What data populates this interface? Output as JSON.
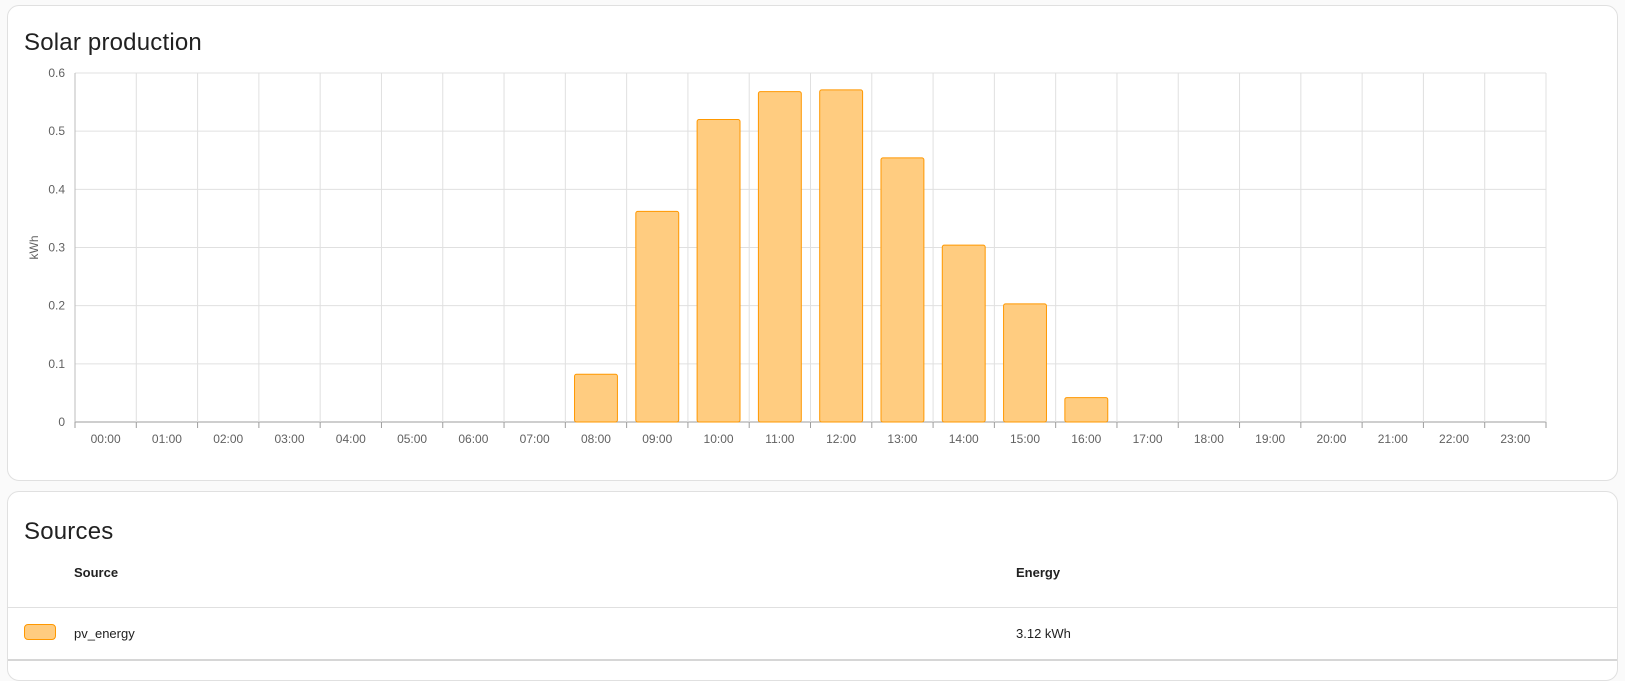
{
  "chart_card": {
    "title": "Solar production"
  },
  "chart_data": {
    "type": "bar",
    "categories": [
      "00:00",
      "01:00",
      "02:00",
      "03:00",
      "04:00",
      "05:00",
      "06:00",
      "07:00",
      "08:00",
      "09:00",
      "10:00",
      "11:00",
      "12:00",
      "13:00",
      "14:00",
      "15:00",
      "16:00",
      "17:00",
      "18:00",
      "19:00",
      "20:00",
      "21:00",
      "22:00",
      "23:00"
    ],
    "values": [
      0,
      0,
      0,
      0,
      0,
      0,
      0,
      0,
      0.082,
      0.362,
      0.52,
      0.568,
      0.571,
      0.454,
      0.304,
      0.203,
      0.042,
      0,
      0,
      0,
      0,
      0,
      0,
      0
    ],
    "ylabel": "kWh",
    "ylim": [
      0,
      0.6
    ],
    "yticks": [
      "0",
      "0.1",
      "0.2",
      "0.3",
      "0.4",
      "0.5",
      "0.6"
    ],
    "grid": true,
    "colors": {
      "bar_fill": "#ffcc80",
      "bar_stroke": "#ff9800"
    }
  },
  "sources_card": {
    "title": "Sources",
    "columns": {
      "source": "Source",
      "energy": "Energy"
    },
    "rows": [
      {
        "source": "pv_energy",
        "energy": "3.12 kWh"
      }
    ]
  }
}
